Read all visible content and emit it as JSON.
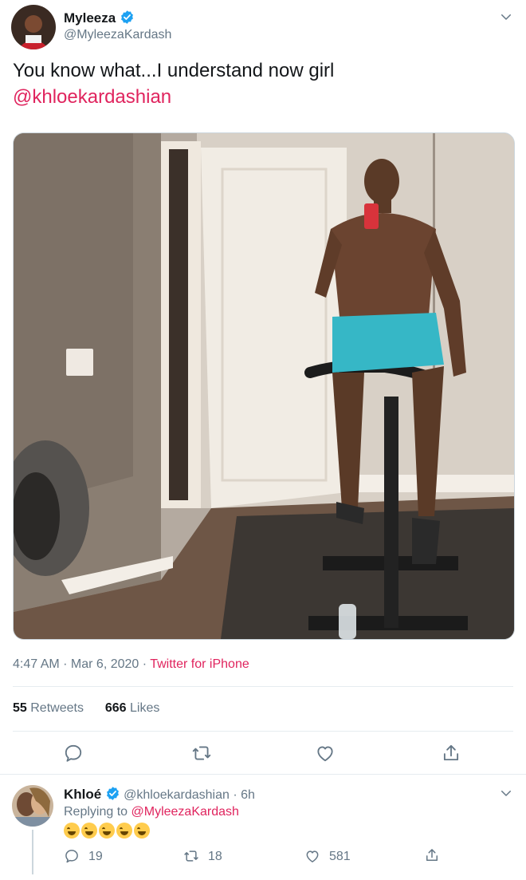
{
  "tweet": {
    "author_name": "Myleeza",
    "author_handle": "@MyleezaKardash",
    "text": "You know what...I understand now girl",
    "mention": "@khloekardashian",
    "timestamp": "4:47 AM · Mar 6, 2020 · ",
    "source": "Twitter for iPhone",
    "retweets_count": "55",
    "retweets_label": "Retweets",
    "likes_count": "666",
    "likes_label": "Likes"
  },
  "reply": {
    "author_name": "Khloé",
    "author_handle": "@khloekardashian",
    "time": " · 6h",
    "replying_prefix": "Replying to ",
    "replying_to": "@MyleezaKardash",
    "emoji_count": 5,
    "comments": "19",
    "retweets": "18",
    "likes": "581"
  },
  "colors": {
    "accent": "#e0245e",
    "verified": "#1da1f2",
    "muted": "#657786"
  },
  "icons": [
    "verified-badge-icon",
    "chevron-down-icon",
    "reply-icon",
    "retweet-icon",
    "like-icon",
    "share-icon"
  ]
}
